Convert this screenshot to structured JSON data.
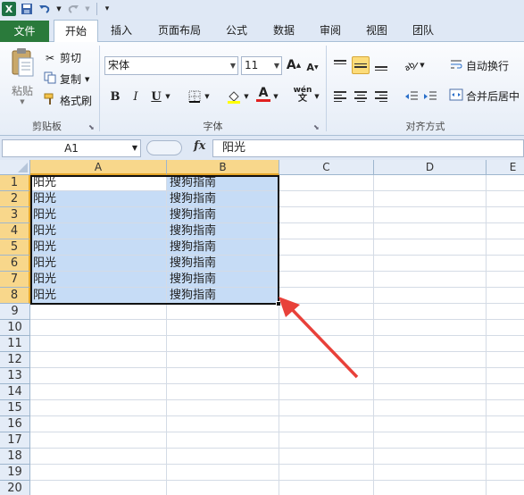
{
  "qat": {
    "icons": [
      "excel-logo",
      "save-icon",
      "undo-icon",
      "redo-icon",
      "customize-icon"
    ]
  },
  "tabs": [
    "文件",
    "开始",
    "插入",
    "页面布局",
    "公式",
    "数据",
    "审阅",
    "视图",
    "团队"
  ],
  "active_tab": "开始",
  "clipboard": {
    "paste": "粘贴",
    "cut": "剪切",
    "copy": "复制",
    "format_painter": "格式刷",
    "group": "剪贴板"
  },
  "font": {
    "name": "宋体",
    "size": "11",
    "bold": "B",
    "italic": "I",
    "underline": "U",
    "font_color_glyph": "A",
    "wen": "wén",
    "group": "字体"
  },
  "alignment": {
    "wrap_text": "自动换行",
    "merge_center": "合并后居中",
    "group": "对齐方式"
  },
  "formula_bar": {
    "name_box": "A1",
    "fx": "fx",
    "value": "阳光"
  },
  "columns": [
    "A",
    "B",
    "C",
    "D",
    "E"
  ],
  "rows": [
    "1",
    "2",
    "3",
    "4",
    "5",
    "6",
    "7",
    "8",
    "9",
    "10",
    "11",
    "12",
    "13",
    "14",
    "15",
    "16",
    "17",
    "18",
    "19",
    "20"
  ],
  "cells": [
    [
      "阳光",
      "搜狗指南"
    ],
    [
      "阳光",
      "搜狗指南"
    ],
    [
      "阳光",
      "搜狗指南"
    ],
    [
      "阳光",
      "搜狗指南"
    ],
    [
      "阳光",
      "搜狗指南"
    ],
    [
      "阳光",
      "搜狗指南"
    ],
    [
      "阳光",
      "搜狗指南"
    ],
    [
      "阳光",
      "搜狗指南"
    ]
  ],
  "colors": {
    "selection": "#c6dcf6",
    "header_selected": "#f8d78b",
    "arrow": "#e8413a",
    "file_tab": "#2a7a3b"
  }
}
